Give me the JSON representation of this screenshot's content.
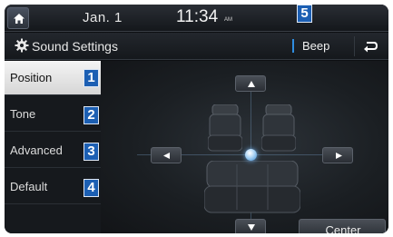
{
  "statusbar": {
    "home_icon": "home-icon",
    "date": "Jan.  1",
    "time": "11:34",
    "ampm": "AM"
  },
  "header": {
    "title": "Sound Settings",
    "title_icon": "gear-icon",
    "beep_label": "Beep",
    "back_icon": "back-arrow-icon"
  },
  "sidebar": {
    "items": [
      {
        "label": "Position",
        "badge": "1",
        "active": true
      },
      {
        "label": "Tone",
        "badge": "2",
        "active": false
      },
      {
        "label": "Advanced",
        "badge": "3",
        "active": false
      },
      {
        "label": "Default",
        "badge": "4",
        "active": false
      }
    ]
  },
  "callouts": {
    "beep_badge": "5"
  },
  "main": {
    "center_label": "Center",
    "arrow_icons": [
      "arrow-up-icon",
      "arrow-down-icon",
      "arrow-left-icon",
      "arrow-right-icon"
    ]
  },
  "colors": {
    "accent": "#2f8de0",
    "badge": "#1c5fb3",
    "active_item": "#e6e6e6",
    "background": "#0d0f12"
  }
}
